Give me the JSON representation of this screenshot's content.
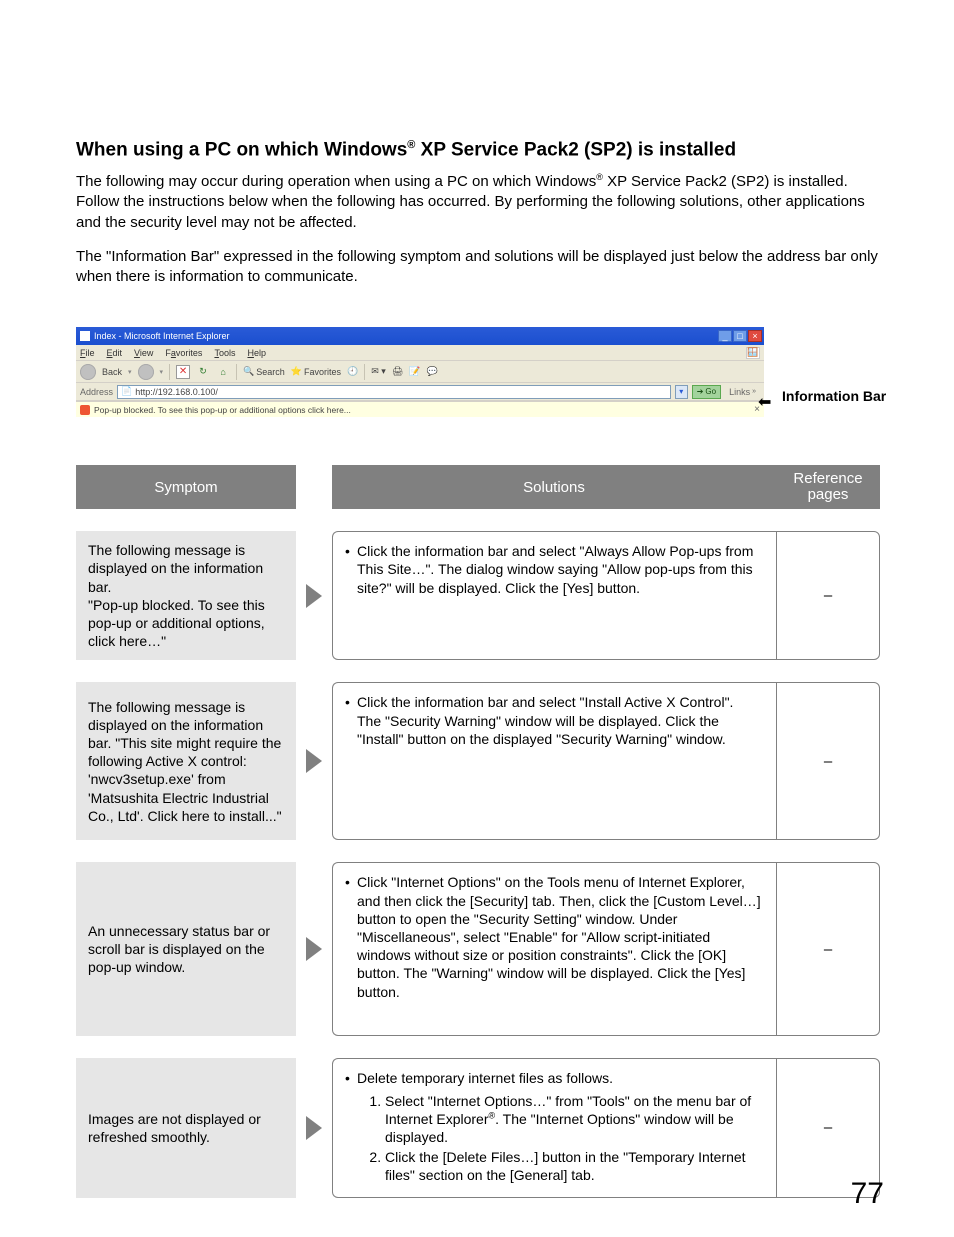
{
  "title_pre": "When using a PC on which Windows",
  "title_sup": "®",
  "title_post": " XP Service Pack2 (SP2) is installed",
  "intro_pre": "The following may occur during operation when using a PC on which Windows",
  "intro_sup": "®",
  "intro_post": " XP Service Pack2 (SP2) is installed. Follow the instructions below when the following has occurred. By performing the following solutions, other applications and the security level may not be affected.",
  "para2": "The \"Information Bar\" expressed in the following symptom and solutions will be displayed just below the address bar only when there is information to communicate.",
  "ie": {
    "title": "Index - Microsoft Internet Explorer",
    "menus": [
      "File",
      "Edit",
      "View",
      "Favorites",
      "Tools",
      "Help"
    ],
    "back": "Back",
    "search": "Search",
    "favorites": "Favorites",
    "address_label": "Address",
    "address_value": "http://192.168.0.100/",
    "go": "Go",
    "links": "Links",
    "infobar_text": "Pop-up blocked. To see this pop-up or additional options click here...",
    "infobar_close": "×"
  },
  "infobar_label": "Information Bar",
  "head": {
    "symptom": "Symptom",
    "solutions": "Solutions",
    "ref": "Reference pages"
  },
  "rows": {
    "0": {
      "symptom": "The following message is displayed on the information bar.\n\"Pop-up blocked. To see this pop-up or additional options, click here…\"",
      "solution": "Click the information bar and select \"Always Allow Pop-ups from This Site…\". The dialog window saying \"Allow pop-ups from this site?\" will be displayed. Click the [Yes] button.",
      "ref": "–"
    },
    "1": {
      "symptom": "The following message is displayed on the information bar. \"This site might require the following Active X control: 'nwcv3setup.exe' from 'Matsushita Electric Industrial Co., Ltd'. Click here to install...\"",
      "solution": "Click the information bar and select \"Install Active X Control\".\nThe \"Security Warning\" window will be displayed. Click the \"Install\" button on the displayed \"Security Warning\" window.",
      "ref": "–"
    },
    "2": {
      "symptom": "An unnecessary status bar or scroll bar is displayed on the pop-up window.",
      "solution": "Click \"Internet Options\" on the Tools menu of Internet Explorer, and then click the [Security] tab. Then, click the [Custom Level…] button to open the \"Security Setting\" window. Under \"Miscellaneous\", select \"Enable\" for \"Allow script-initiated windows without size or position constraints\". Click the [OK] button. The \"Warning\" window will be displayed. Click the [Yes] button.",
      "ref": "–"
    },
    "3": {
      "symptom": "Images are not displayed or refreshed smoothly.",
      "solution_lead": "Delete temporary internet files as follows.",
      "step1_pre": "Select \"Internet Options…\" from \"Tools\" on the menu bar of Internet Explorer",
      "step1_post": ". The \"Internet Options\" window will be displayed.",
      "step2": "Click the [Delete Files…] button in the \"Temporary Internet files\" section on the [General] tab.",
      "ref": "–"
    }
  },
  "page_number": "77"
}
